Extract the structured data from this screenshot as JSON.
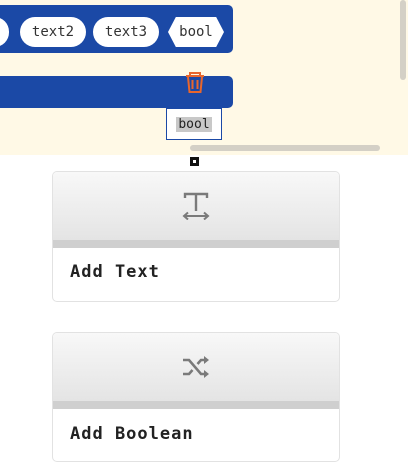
{
  "workspace": {
    "top_block": {
      "pills": [
        "",
        "text2",
        "text3",
        "bool"
      ]
    },
    "drag_label": "bool",
    "trash_icon": "trash-icon"
  },
  "palette": {
    "cards": [
      {
        "label": "Add Text",
        "icon": "text-icon"
      },
      {
        "label": "Add Boolean",
        "icon": "shuffle-icon"
      }
    ]
  },
  "colors": {
    "block_blue": "#1b49a6",
    "workspace_bg": "#fff9e6",
    "trash_orange": "#e8662c",
    "icon_gray": "#7a7a7a"
  }
}
